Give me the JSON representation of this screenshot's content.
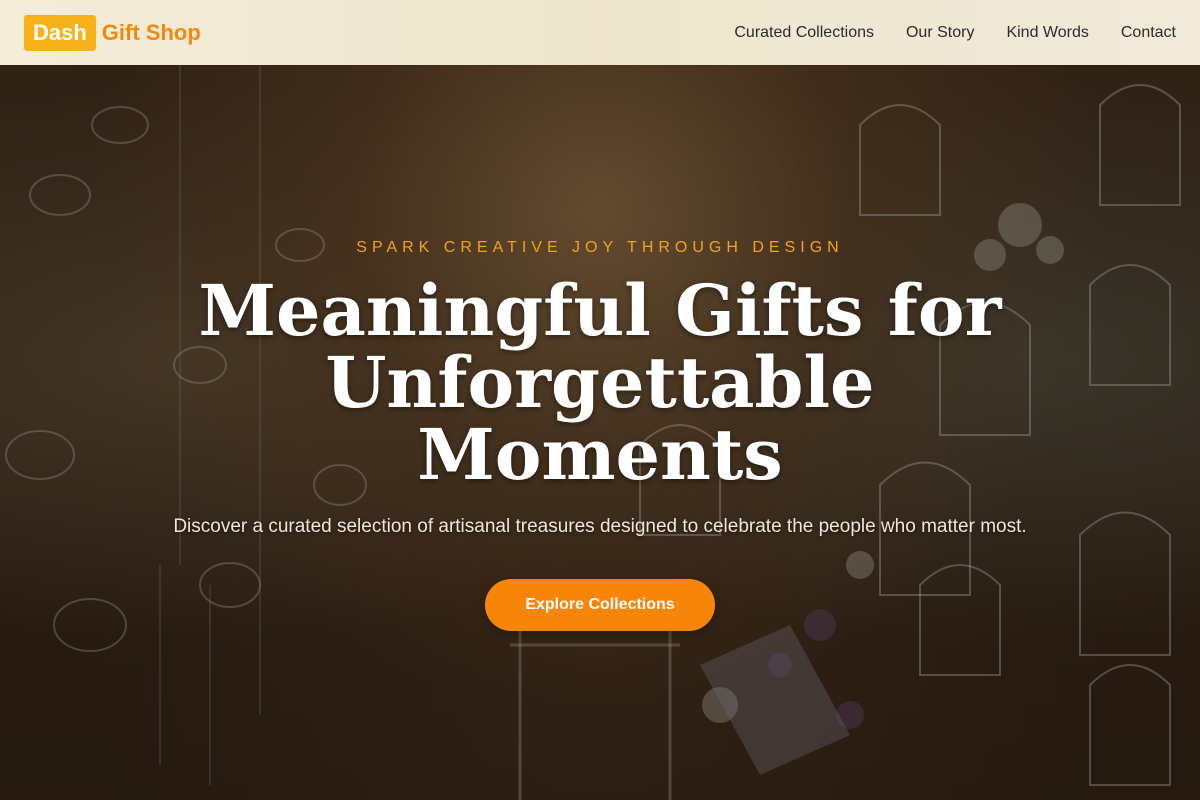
{
  "brand": {
    "badge": "Dash",
    "name": "Gift Shop",
    "badge_color": "#f7b21a",
    "name_color": "#f08a0c"
  },
  "nav": {
    "items": [
      {
        "label": "Curated Collections"
      },
      {
        "label": "Our Story"
      },
      {
        "label": "Kind Words"
      },
      {
        "label": "Contact"
      }
    ]
  },
  "hero": {
    "tagline": "SPARK CREATIVE JOY THROUGH DESIGN",
    "headline_line1": "Meaningful Gifts for",
    "headline_line2": "Unforgettable Moments",
    "subtext": "Discover a curated selection of artisanal treasures designed to celebrate the people who matter most.",
    "cta_label": "Explore Collections",
    "accent_color": "#f7850a",
    "background_image": "gift shop interior with hanging birdcages, teacups and flowers"
  }
}
